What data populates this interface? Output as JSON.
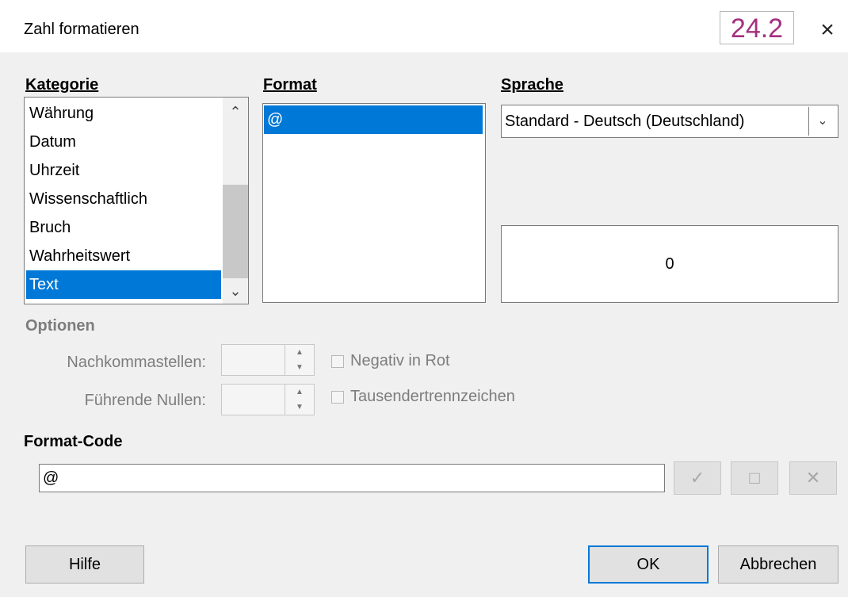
{
  "window": {
    "title": "Zahl formatieren",
    "version_badge": "24.2",
    "close_glyph": "×"
  },
  "category": {
    "heading": "Kategorie",
    "items": [
      {
        "label": "Währung",
        "selected": false
      },
      {
        "label": "Datum",
        "selected": false
      },
      {
        "label": "Uhrzeit",
        "selected": false
      },
      {
        "label": "Wissenschaftlich",
        "selected": false
      },
      {
        "label": "Bruch",
        "selected": false
      },
      {
        "label": "Wahrheitswert",
        "selected": false
      },
      {
        "label": "Text",
        "selected": true
      }
    ],
    "scroll_up": "⌃",
    "scroll_down": "⌄"
  },
  "format": {
    "heading": "Format",
    "items": [
      {
        "label": "@",
        "selected": true
      }
    ]
  },
  "language": {
    "heading": "Sprache",
    "selected": "Standard - Deutsch (Deutschland)",
    "arrow": "⌄"
  },
  "preview": {
    "value": "0"
  },
  "options": {
    "heading": "Optionen",
    "decimal_places_label": "Nachkommastellen:",
    "decimal_places_value": "",
    "leading_zeros_label": "Führende Nullen:",
    "leading_zeros_value": "",
    "negative_red_label": "Negativ in Rot",
    "negative_red_checked": false,
    "thousands_sep_label": "Tausendertrennzeichen",
    "thousands_sep_checked": false
  },
  "format_code": {
    "heading": "Format-Code",
    "value": "@",
    "accept_icon": "✓",
    "comment_icon": "□",
    "delete_icon": "✕"
  },
  "buttons": {
    "help": "Hilfe",
    "ok": "OK",
    "cancel": "Abbrechen"
  },
  "colors": {
    "selection": "#0078d7",
    "badge_text": "#a4307e",
    "disabled_text": "#7d7d7d"
  }
}
